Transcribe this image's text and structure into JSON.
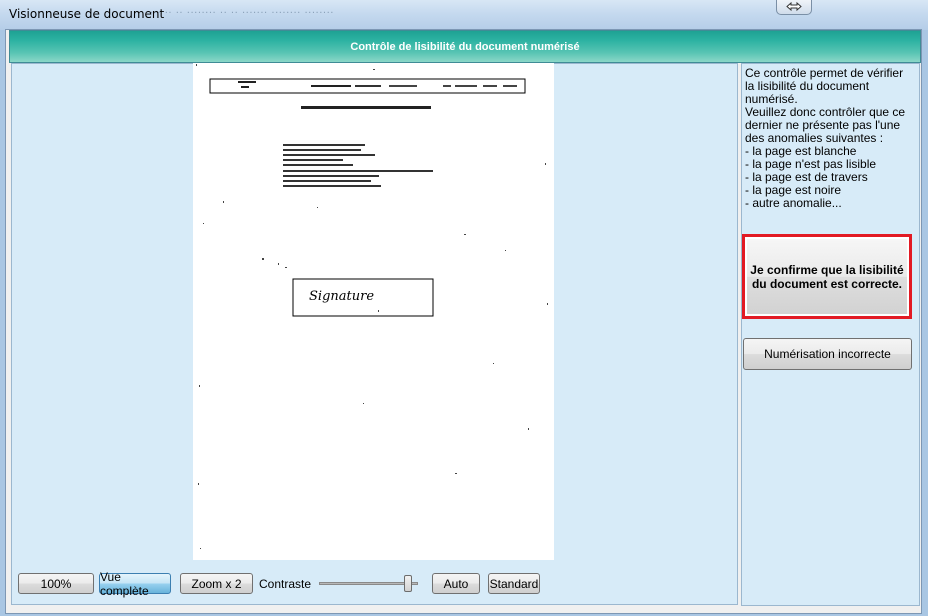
{
  "window": {
    "title": "Visionneuse de document",
    "blurred_title": "··· ·· ·· ········ ·· ·· ······· ········ ········"
  },
  "header": {
    "title": "Contrôle de lisibilité du document numérisé"
  },
  "document": {
    "signature_text": "Signature"
  },
  "toolbar": {
    "zoom_100_label": "100%",
    "full_view_label": "Vue complète",
    "zoom_x2_label": "Zoom x 2",
    "contrast_label": "Contraste",
    "contrast_level": 0.9,
    "auto_label": "Auto",
    "standard_label": "Standard"
  },
  "side_panel": {
    "info_text": "Ce contrôle permet de vérifier la lisibilité du document numérisé.\nVeuillez donc contrôler que ce dernier ne présente pas l'une des anomalies suivantes :\n- la page est blanche\n- la page n'est pas lisible\n- la page est de travers\n- la page est noire\n- autre anomalie...",
    "confirm_label": "Je confirme que la lisibilité du document est correcte.",
    "incorrect_label": "Numérisation incorrecte"
  },
  "colors": {
    "header_gradient_start": "#1ea293",
    "confirm_border": "#e21a24",
    "panel_bg": "#d7ebf8"
  }
}
